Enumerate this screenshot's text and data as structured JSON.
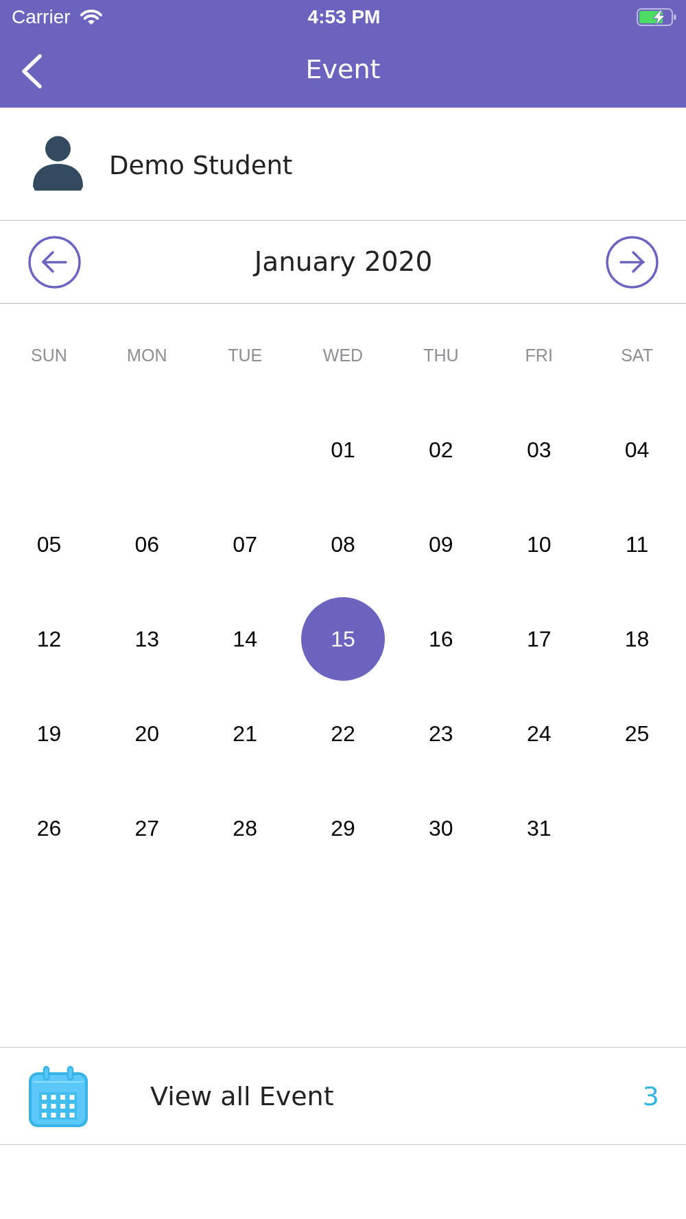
{
  "status_bar": {
    "carrier": "Carrier",
    "time": "4:53 PM"
  },
  "nav_bar": {
    "title": "Event"
  },
  "profile": {
    "name": "Demo Student"
  },
  "calendar": {
    "month": "January 2020",
    "weekdays": [
      "SUN",
      "MON",
      "TUE",
      "WED",
      "THU",
      "FRI",
      "SAT"
    ],
    "weeks": [
      [
        {
          "kind": "blank"
        },
        {
          "kind": "blank"
        },
        {
          "kind": "blank"
        },
        {
          "kind": "day",
          "day": "01",
          "selected": false
        },
        {
          "kind": "day",
          "day": "02",
          "selected": false
        },
        {
          "kind": "day",
          "day": "03",
          "selected": false
        },
        {
          "kind": "day",
          "day": "04",
          "selected": false
        }
      ],
      [
        {
          "kind": "day",
          "day": "05",
          "selected": false
        },
        {
          "kind": "day",
          "day": "06",
          "selected": false
        },
        {
          "kind": "day",
          "day": "07",
          "selected": false
        },
        {
          "kind": "day",
          "day": "08",
          "selected": false
        },
        {
          "kind": "day",
          "day": "09",
          "selected": false
        },
        {
          "kind": "day",
          "day": "10",
          "selected": false
        },
        {
          "kind": "day",
          "day": "11",
          "selected": false
        }
      ],
      [
        {
          "kind": "day",
          "day": "12",
          "selected": false
        },
        {
          "kind": "day",
          "day": "13",
          "selected": false
        },
        {
          "kind": "day",
          "day": "14",
          "selected": false
        },
        {
          "kind": "day",
          "day": "15",
          "selected": true
        },
        {
          "kind": "day",
          "day": "16",
          "selected": false
        },
        {
          "kind": "day",
          "day": "17",
          "selected": false
        },
        {
          "kind": "day",
          "day": "18",
          "selected": false
        }
      ],
      [
        {
          "kind": "day",
          "day": "19",
          "selected": false
        },
        {
          "kind": "day",
          "day": "20",
          "selected": false
        },
        {
          "kind": "day",
          "day": "21",
          "selected": false
        },
        {
          "kind": "day",
          "day": "22",
          "selected": false
        },
        {
          "kind": "day",
          "day": "23",
          "selected": false
        },
        {
          "kind": "day",
          "day": "24",
          "selected": false
        },
        {
          "kind": "day",
          "day": "25",
          "selected": false
        }
      ],
      [
        {
          "kind": "day",
          "day": "26",
          "selected": false
        },
        {
          "kind": "day",
          "day": "27",
          "selected": false
        },
        {
          "kind": "day",
          "day": "28",
          "selected": false
        },
        {
          "kind": "day",
          "day": "29",
          "selected": false
        },
        {
          "kind": "day",
          "day": "30",
          "selected": false
        },
        {
          "kind": "day",
          "day": "31",
          "selected": false
        },
        {
          "kind": "blank"
        }
      ]
    ]
  },
  "events_link": {
    "label": "View all Event",
    "count": "3"
  }
}
